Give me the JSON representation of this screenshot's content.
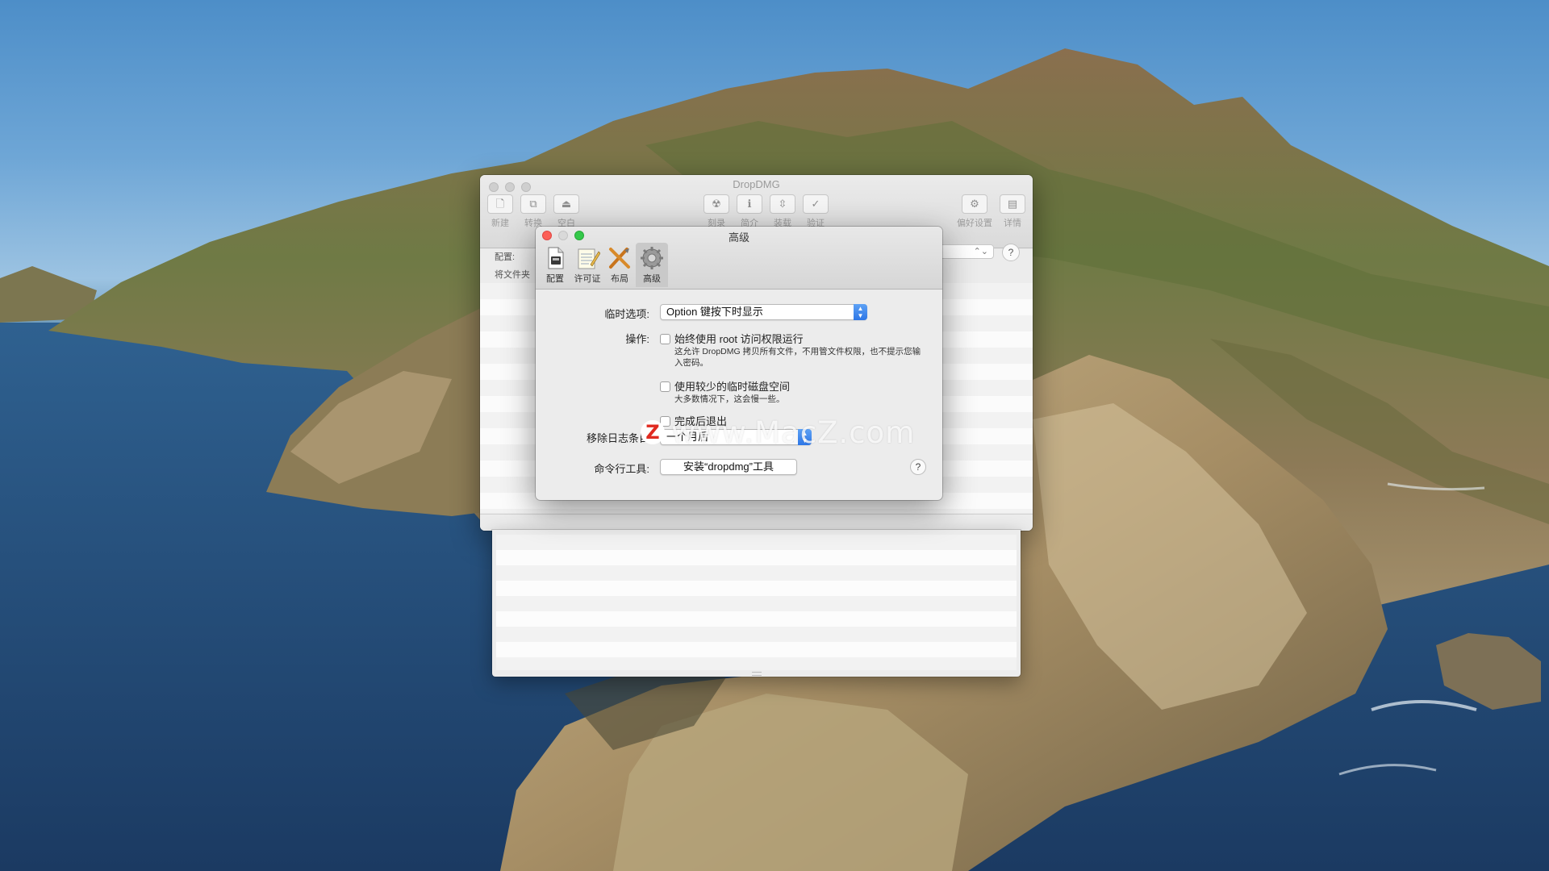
{
  "colors": {
    "sky": "#6ea6d6",
    "sea": "#264f78",
    "accent_blue": "#2d76e6",
    "close_red": "#fc5f57",
    "zoom_green": "#34c84a",
    "watermark_red": "#e02a20"
  },
  "main_window": {
    "title": "DropDMG",
    "toolbar": [
      {
        "label": "新建",
        "icon": "new-document-icon",
        "glyph": "🗋"
      },
      {
        "label": "转换",
        "icon": "convert-icon",
        "glyph": "⧉"
      },
      {
        "label": "空白",
        "icon": "blank-disk-icon",
        "glyph": "⏏"
      },
      {
        "label": "刻录",
        "icon": "burn-icon",
        "glyph": "☢"
      },
      {
        "label": "简介",
        "icon": "info-icon",
        "glyph": "ℹ"
      },
      {
        "label": "装载",
        "icon": "mount-icon",
        "glyph": "⇳"
      },
      {
        "label": "验证",
        "icon": "verify-checkmark-icon",
        "glyph": "✓"
      },
      {
        "label": "偏好设置",
        "icon": "gear-icon",
        "glyph": "⚙"
      },
      {
        "label": "详情",
        "icon": "details-icon",
        "glyph": "▤"
      }
    ],
    "config_label": "配置:",
    "drop_hint": "将文件夹",
    "help": "?"
  },
  "prefs_window": {
    "title": "高级",
    "tabs": [
      {
        "label": "配置",
        "icon": "config-document-icon"
      },
      {
        "label": "许可证",
        "icon": "license-notepad-icon"
      },
      {
        "label": "布局",
        "icon": "layout-tools-icon"
      },
      {
        "label": "高级",
        "icon": "advanced-gear-icon",
        "active": true
      }
    ],
    "temp_option_label": "临时选项:",
    "temp_option_value": "Option 键按下时显示",
    "action_label": "操作:",
    "always_root_label": "始终使用 root 访问权限运行",
    "always_root_checked": false,
    "always_root_note": "这允许 DropDMG 拷贝所有文件，不用管文件权限，也不提示您输入密码。",
    "less_disk_label": "使用较少的临时磁盘空间",
    "less_disk_checked": false,
    "less_disk_note": "大多数情况下，这会慢一些。",
    "quit_after_label": "完成后退出",
    "quit_after_checked": false,
    "remove_log_label": "移除日志条目",
    "remove_log_value": "一个月后",
    "cli_label": "命令行工具:",
    "cli_button": "安装“dropdmg”工具",
    "help": "?"
  },
  "watermark": {
    "logo_letter": "Z",
    "text": "www.MacZ.com"
  }
}
